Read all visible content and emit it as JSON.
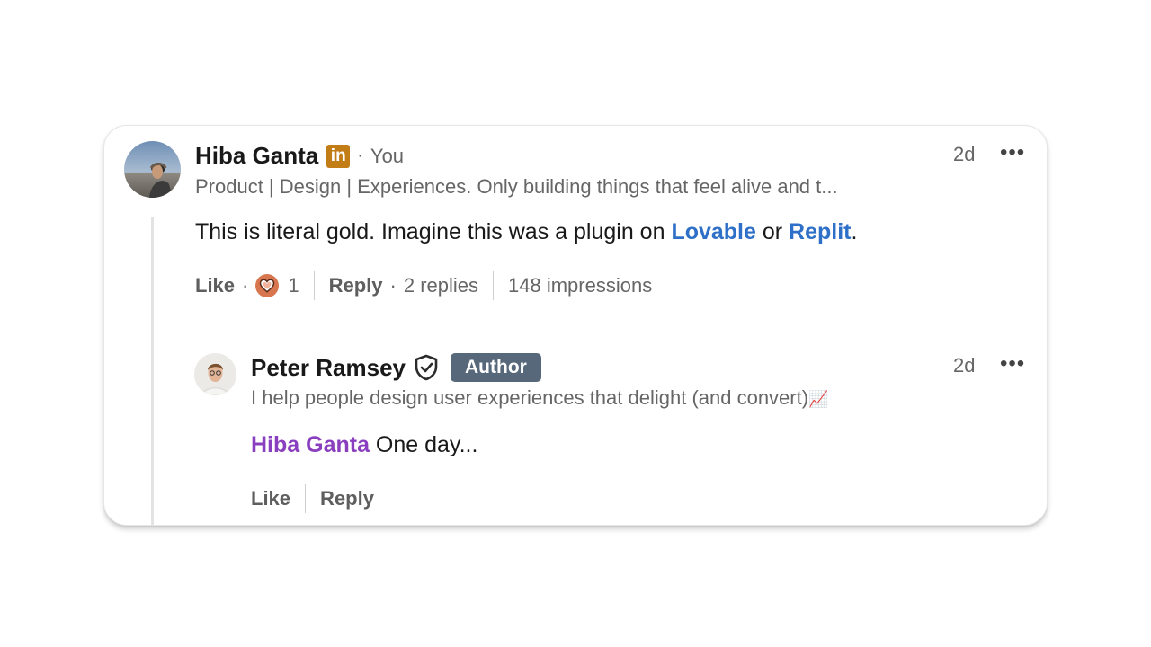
{
  "comment": {
    "author": "Hiba Ganta",
    "badge_text": "in",
    "you_label": "You",
    "headline": "Product | Design | Experiences. Only building things that feel alive and t...",
    "time": "2d",
    "more": "•••",
    "text_prefix": "This is literal gold. Imagine this was a plugin on ",
    "link1": "Lovable",
    "text_middle": " or ",
    "link2": "Replit",
    "text_suffix": ".",
    "like_label": "Like",
    "reaction_count": "1",
    "reply_label": "Reply",
    "replies_count": "2 replies",
    "impressions": "148 impressions"
  },
  "reply": {
    "author": "Peter Ramsey",
    "author_badge": "Author",
    "headline": "I help people design user experiences that delight (and convert)",
    "headline_emoji": "📈",
    "time": "2d",
    "more": "•••",
    "mention": "Hiba Ganta",
    "text": " One day...",
    "like_label": "Like",
    "reply_label": "Reply"
  },
  "colors": {
    "link": "#2e6fc7",
    "mention": "#8a3fbf",
    "linkedin_badge": "#c37d16",
    "author_badge": "#56687a",
    "reaction": "#d8774f"
  },
  "icons": [
    "linkedin-icon",
    "verified-shield-icon",
    "heart-reaction-icon",
    "more-icon"
  ]
}
